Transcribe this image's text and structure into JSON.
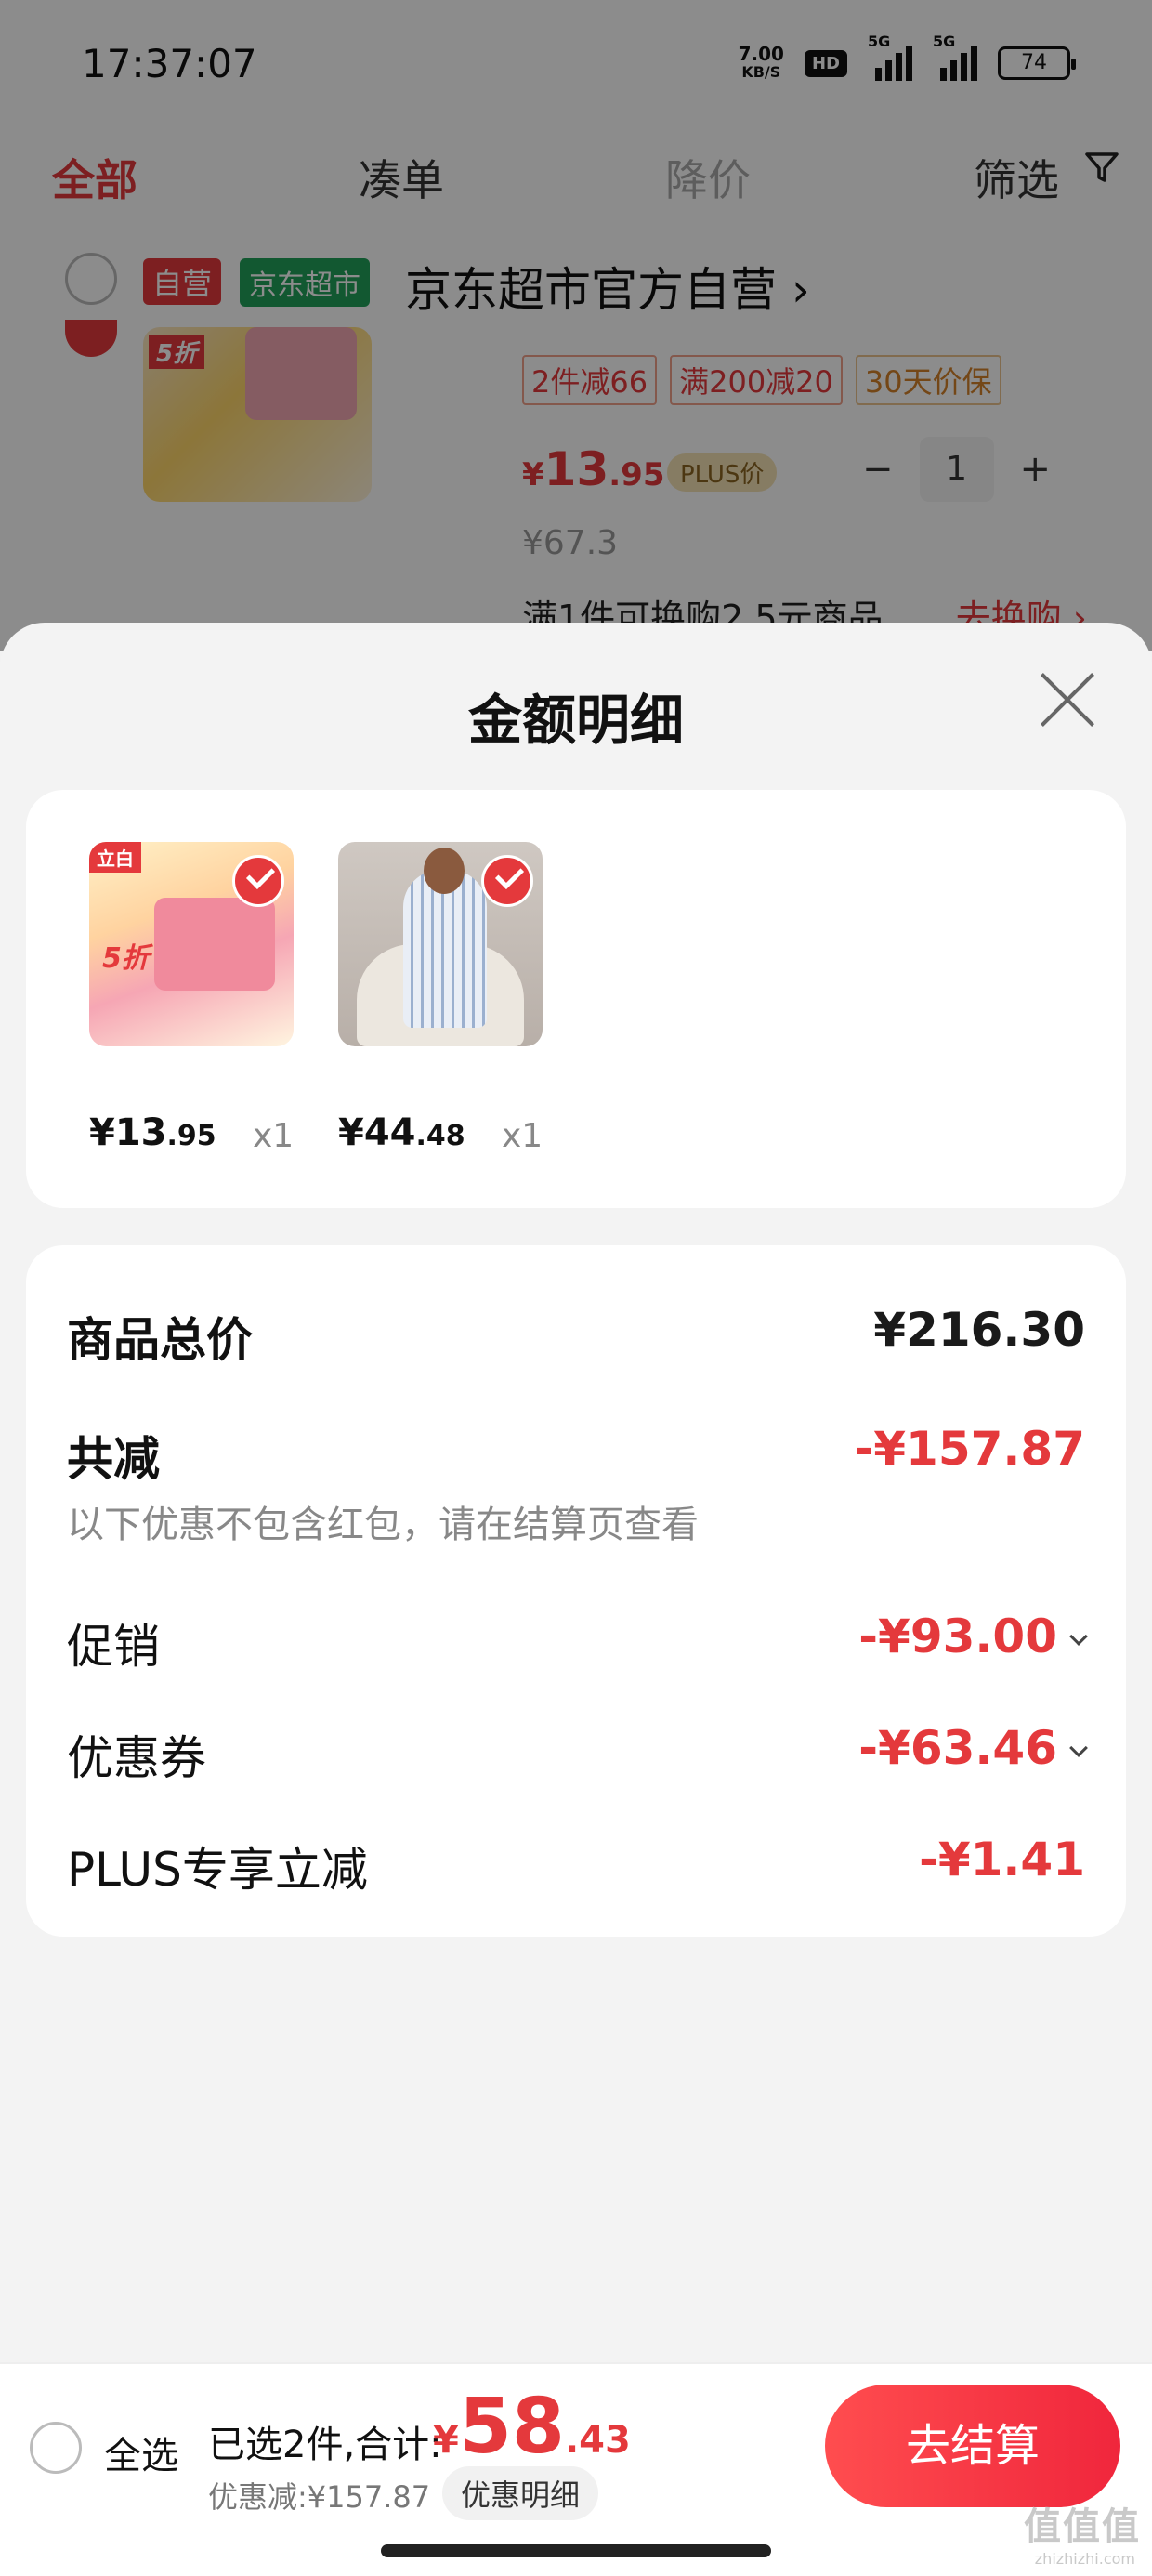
{
  "status_bar": {
    "time": "17:37:07",
    "net_speed_value": "7.00",
    "net_speed_unit": "KB/S",
    "hd_label": "HD",
    "signal1_label": "5G",
    "signal2_label": "5G",
    "battery": "74"
  },
  "tabs": {
    "all": "全部",
    "bundle": "凑单",
    "price_drop": "降价",
    "filter": "筛选"
  },
  "background_shop": {
    "self_tag": "自营",
    "jd_tag": "京东超市",
    "shop_name": "京东超市官方自营",
    "shop_arrow": "›",
    "product_badge": "5折",
    "promo_tags": [
      "2件减66",
      "满200减20",
      "30天价保"
    ],
    "price_currency": "¥",
    "price_int": "13",
    "price_dec": ".95",
    "plus_tag": "PLUS价",
    "qty_minus": "−",
    "qty_value": "1",
    "qty_plus": "+",
    "original_price": "¥67.3",
    "exchange_text": "满1件可换购2.5元商品",
    "exchange_link": "去换购 ›"
  },
  "sheet": {
    "title": "金额明细",
    "items": [
      {
        "logo": "立白",
        "badge": "5折",
        "price_currency": "¥",
        "price_int": "13",
        "price_dec": ".95",
        "count": "x1"
      },
      {
        "price_currency": "¥",
        "price_int": "44",
        "price_dec": ".48",
        "count": "x1"
      }
    ],
    "summary": {
      "total_label": "商品总价",
      "total_value": "¥216.30",
      "reduce_label": "共减",
      "reduce_value": "-¥157.87",
      "note": "以下优惠不包含红包，请在结算页查看",
      "promo_label": "促销",
      "promo_value": "-¥93.00",
      "coupon_label": "优惠券",
      "coupon_value": "-¥63.46",
      "plus_label": "PLUS专享立减",
      "plus_value": "-¥1.41"
    }
  },
  "bottom_bar": {
    "select_all": "全选",
    "selected_count": "已选2件,合计:",
    "total_currency": "¥",
    "total_int": "58",
    "total_dec": ".43",
    "saved": "优惠减:¥157.87",
    "detail_button": "优惠明细",
    "checkout_button": "去结算",
    "watermark": "值值值",
    "watermark_sub": "zhizhizhi.com"
  },
  "colors": {
    "accent": "#e4393c",
    "jd_green": "#21a059"
  }
}
